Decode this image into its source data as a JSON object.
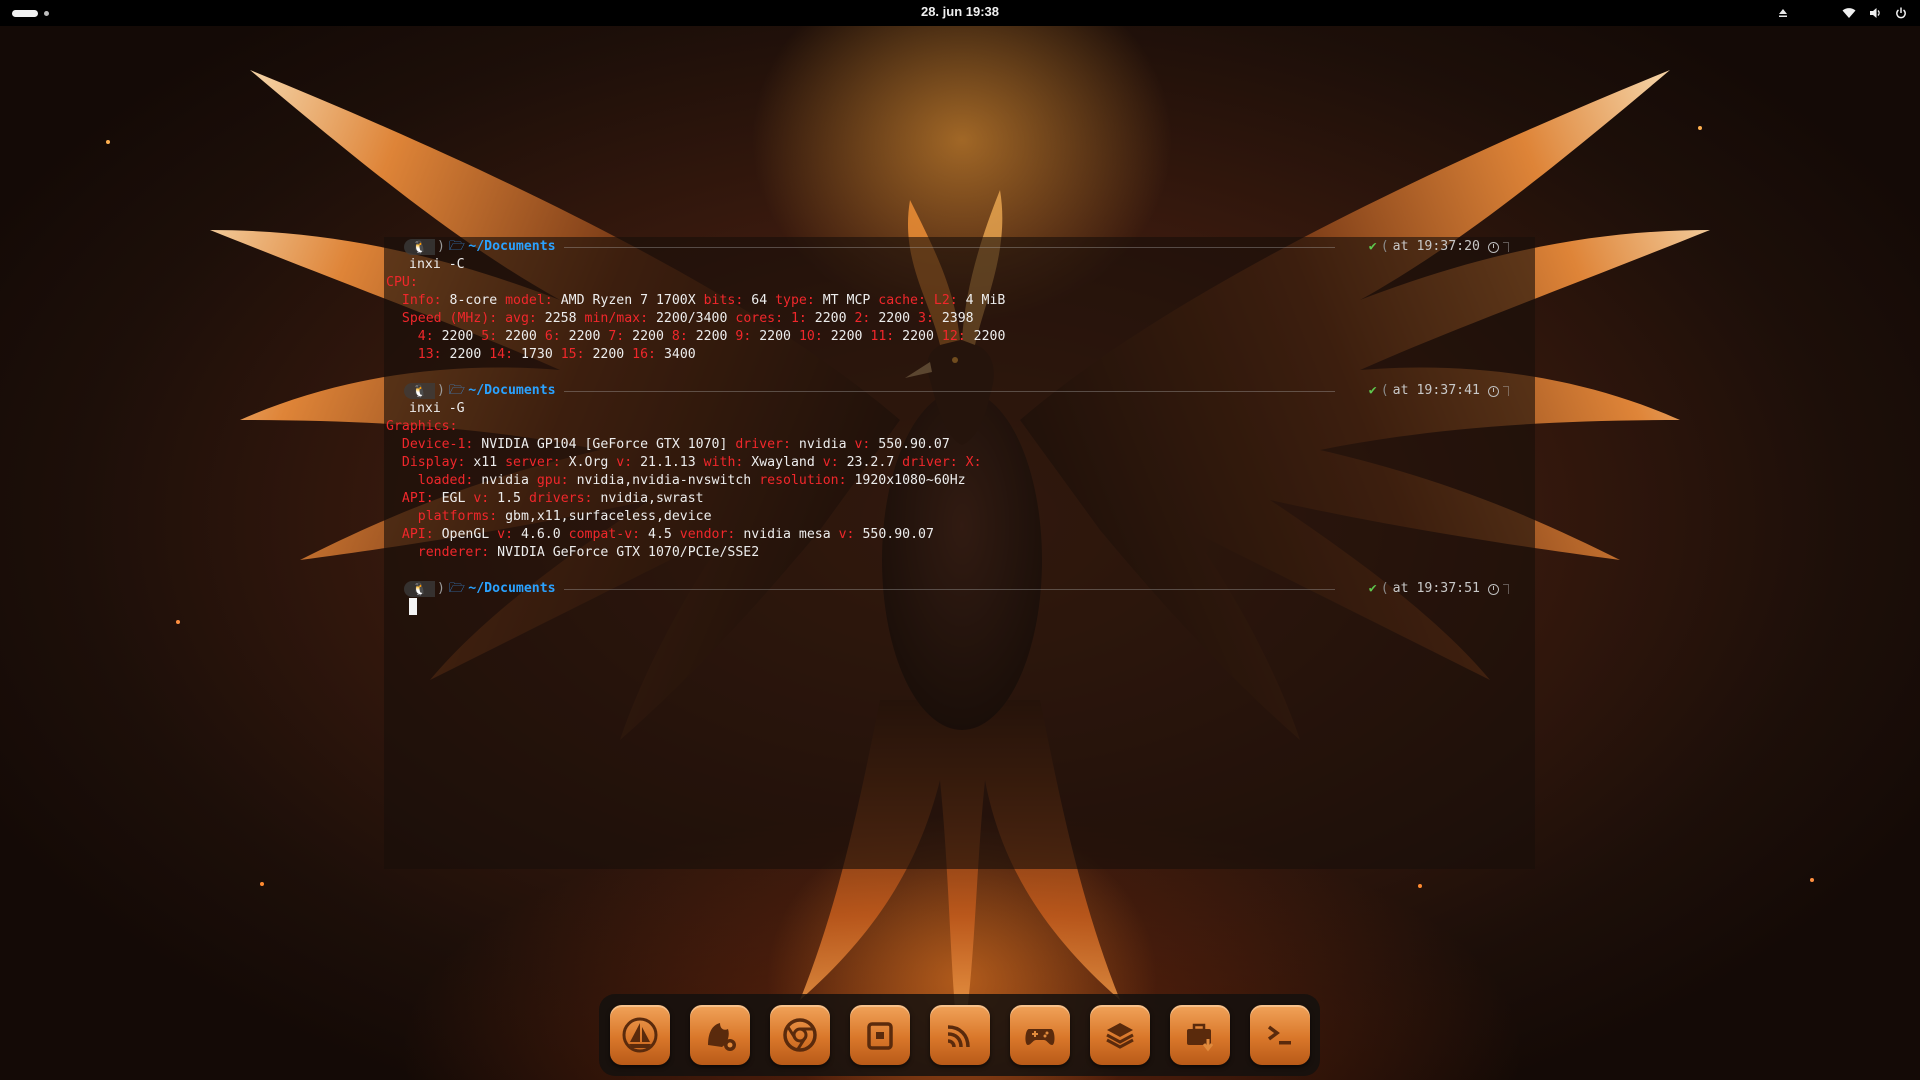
{
  "topbar": {
    "datetime": "28. jun  19:38"
  },
  "terminal": {
    "blocks": [
      {
        "directory": "~/Documents",
        "time": "at 19:37:20",
        "command": "inxi -C",
        "output": [
          [
            [
              "r",
              "CPU:"
            ]
          ],
          [
            [
              "r",
              "  Info: "
            ],
            [
              "w",
              "8-core "
            ],
            [
              "r",
              "model: "
            ],
            [
              "w",
              "AMD Ryzen 7 1700X "
            ],
            [
              "r",
              "bits: "
            ],
            [
              "w",
              "64 "
            ],
            [
              "r",
              "type: "
            ],
            [
              "w",
              "MT MCP "
            ],
            [
              "r",
              "cache: L2: "
            ],
            [
              "w",
              "4 MiB"
            ]
          ],
          [
            [
              "r",
              "  Speed (MHz): "
            ],
            [
              "r",
              "avg: "
            ],
            [
              "w",
              "2258 "
            ],
            [
              "r",
              "min/max: "
            ],
            [
              "w",
              "2200/3400 "
            ],
            [
              "r",
              "cores: 1: "
            ],
            [
              "w",
              "2200 "
            ],
            [
              "r",
              "2: "
            ],
            [
              "w",
              "2200 "
            ],
            [
              "r",
              "3: "
            ],
            [
              "w",
              "2398"
            ]
          ],
          [
            [
              "r",
              "    4: "
            ],
            [
              "w",
              "2200 "
            ],
            [
              "r",
              "5: "
            ],
            [
              "w",
              "2200 "
            ],
            [
              "r",
              "6: "
            ],
            [
              "w",
              "2200 "
            ],
            [
              "r",
              "7: "
            ],
            [
              "w",
              "2200 "
            ],
            [
              "r",
              "8: "
            ],
            [
              "w",
              "2200 "
            ],
            [
              "r",
              "9: "
            ],
            [
              "w",
              "2200 "
            ],
            [
              "r",
              "10: "
            ],
            [
              "w",
              "2200 "
            ],
            [
              "r",
              "11: "
            ],
            [
              "w",
              "2200 "
            ],
            [
              "r",
              "12: "
            ],
            [
              "w",
              "2200"
            ]
          ],
          [
            [
              "r",
              "    13: "
            ],
            [
              "w",
              "2200 "
            ],
            [
              "r",
              "14: "
            ],
            [
              "w",
              "1730 "
            ],
            [
              "r",
              "15: "
            ],
            [
              "w",
              "2200 "
            ],
            [
              "r",
              "16: "
            ],
            [
              "w",
              "3400"
            ]
          ]
        ]
      },
      {
        "directory": "~/Documents",
        "time": "at 19:37:41",
        "command": "inxi -G",
        "output": [
          [
            [
              "r",
              "Graphics:"
            ]
          ],
          [
            [
              "r",
              "  Device-1: "
            ],
            [
              "w",
              "NVIDIA GP104 [GeForce GTX 1070] "
            ],
            [
              "r",
              "driver: "
            ],
            [
              "w",
              "nvidia "
            ],
            [
              "r",
              "v: "
            ],
            [
              "w",
              "550.90.07"
            ]
          ],
          [
            [
              "r",
              "  Display: "
            ],
            [
              "w",
              "x11 "
            ],
            [
              "r",
              "server: "
            ],
            [
              "w",
              "X.Org "
            ],
            [
              "r",
              "v: "
            ],
            [
              "w",
              "21.1.13 "
            ],
            [
              "r",
              "with: "
            ],
            [
              "w",
              "Xwayland "
            ],
            [
              "r",
              "v: "
            ],
            [
              "w",
              "23.2.7 "
            ],
            [
              "r",
              "driver: X:"
            ]
          ],
          [
            [
              "r",
              "    loaded: "
            ],
            [
              "w",
              "nvidia "
            ],
            [
              "r",
              "gpu: "
            ],
            [
              "w",
              "nvidia,nvidia-nvswitch "
            ],
            [
              "r",
              "resolution: "
            ],
            [
              "w",
              "1920x1080~60Hz"
            ]
          ],
          [
            [
              "r",
              "  API: "
            ],
            [
              "w",
              "EGL "
            ],
            [
              "r",
              "v: "
            ],
            [
              "w",
              "1.5 "
            ],
            [
              "r",
              "drivers: "
            ],
            [
              "w",
              "nvidia,swrast"
            ]
          ],
          [
            [
              "r",
              "    platforms: "
            ],
            [
              "w",
              "gbm,x11,surfaceless,device"
            ]
          ],
          [
            [
              "r",
              "  API: "
            ],
            [
              "w",
              "OpenGL "
            ],
            [
              "r",
              "v: "
            ],
            [
              "w",
              "4.6.0 "
            ],
            [
              "r",
              "compat-v: "
            ],
            [
              "w",
              "4.5 "
            ],
            [
              "r",
              "vendor: "
            ],
            [
              "w",
              "nvidia mesa "
            ],
            [
              "r",
              "v: "
            ],
            [
              "w",
              "550.90.07"
            ]
          ],
          [
            [
              "r",
              "    renderer: "
            ],
            [
              "w",
              "NVIDIA GeForce GTX 1070/PCIe/SSE2"
            ]
          ]
        ]
      },
      {
        "directory": "~/Documents",
        "time": "at 19:37:51",
        "command": "",
        "output": []
      }
    ]
  },
  "dock": {
    "items": [
      {
        "icon": "boat-launcher-icon"
      },
      {
        "icon": "app-settings-icon"
      },
      {
        "icon": "browser-icon"
      },
      {
        "icon": "files-icon"
      },
      {
        "icon": "podcast-icon"
      },
      {
        "icon": "gamepad-icon"
      },
      {
        "icon": "stack-icon"
      },
      {
        "icon": "toolbox-icon"
      },
      {
        "icon": "terminal-icon"
      }
    ]
  },
  "colors": {
    "accent": "#d9772a",
    "prompt_dir": "#2aa2ff",
    "label_red": "#f0272b",
    "ok_green": "#5ec84e"
  }
}
